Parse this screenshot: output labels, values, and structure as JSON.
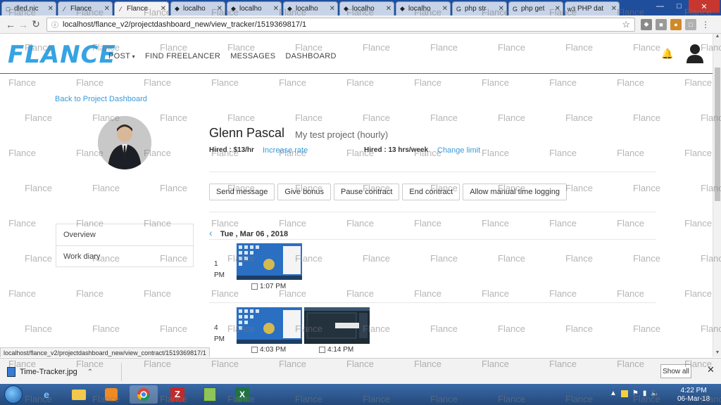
{
  "browser": {
    "tabs": [
      {
        "label": "dled.nic",
        "icon": "doc-icon"
      },
      {
        "label": "Flance",
        "icon": "flance-icon"
      },
      {
        "label": "Flance",
        "icon": "flance-icon",
        "active": true
      },
      {
        "label": "localho",
        "icon": "pma-icon"
      },
      {
        "label": "localho",
        "icon": "pma-icon"
      },
      {
        "label": "localho",
        "icon": "pma-icon"
      },
      {
        "label": "localho",
        "icon": "pma-icon"
      },
      {
        "label": "localho",
        "icon": "pma-icon"
      },
      {
        "label": "php str",
        "icon": "google-icon"
      },
      {
        "label": "php get",
        "icon": "google-icon"
      },
      {
        "label": "PHP dat",
        "icon": "w3-icon"
      }
    ],
    "url": "localhost/flance_v2/projectdashboard_new/view_tracker/1519369817/1",
    "status_url": "localhost/flance_v2/projectdashboard_new/view_contract/1519369817/1"
  },
  "site": {
    "logo": "FLANCE",
    "nav": [
      "POST",
      "FIND FREELANCER",
      "MESSAGES",
      "DASHBOARD"
    ],
    "back_link": "Back to Project Dashboard"
  },
  "contract": {
    "freelancer_name": "Glenn Pascal",
    "project_title": "My test project (hourly)",
    "hired_rate": "Hired : $13/hr",
    "increase_rate": "Increase rate",
    "hired_hours": "Hired : 13 hrs/week",
    "change_limit": "Change limit"
  },
  "actions": [
    "Send message",
    "Give bonus",
    "Pause contract",
    "End contract",
    "Allow manual time logging"
  ],
  "sidemenu": [
    "Overview",
    "Work diary"
  ],
  "diary": {
    "date": "Tue , Mar 06 , 2018",
    "slots": [
      {
        "hour": "1",
        "period": "PM",
        "shots": [
          "1:07 PM"
        ]
      },
      {
        "hour": "4",
        "period": "PM",
        "shots": [
          "4:03 PM",
          "4:14 PM"
        ]
      }
    ]
  },
  "downloads": {
    "file": "Time-Tracker.jpg",
    "show_all": "Show all"
  },
  "taskbar": {
    "time": "4:22 PM",
    "date": "06-Mar-18"
  },
  "watermark_text": "Flance",
  "colors": {
    "accent": "#3a9ad9",
    "logo": "#36a3e3",
    "header_border": "#2d6da3"
  }
}
